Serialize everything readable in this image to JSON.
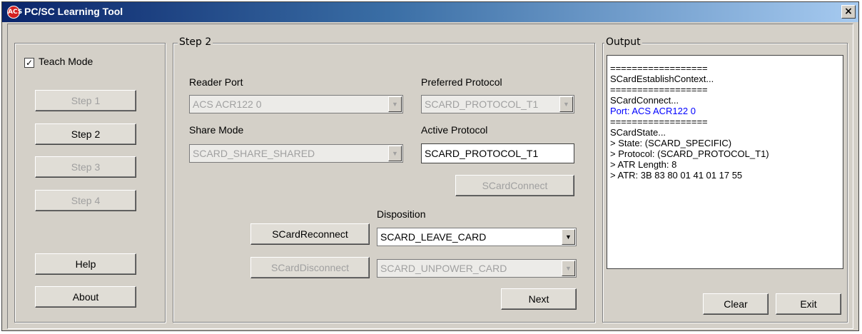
{
  "window": {
    "title": "PC/SC Learning Tool",
    "icon": "acs-logo-icon",
    "close_label": "×"
  },
  "left_panel": {
    "teach_mode_label": "Teach Mode",
    "teach_mode_checked": true,
    "steps": [
      {
        "label": "Step 1",
        "enabled": false
      },
      {
        "label": "Step 2",
        "enabled": true
      },
      {
        "label": "Step 3",
        "enabled": false
      },
      {
        "label": "Step 4",
        "enabled": false
      }
    ],
    "help_label": "Help",
    "about_label": "About"
  },
  "step_panel": {
    "title": "Step 2",
    "reader_port_label": "Reader Port",
    "reader_port_value": "ACS ACR122 0",
    "preferred_protocol_label": "Preferred Protocol",
    "preferred_protocol_value": "SCARD_PROTOCOL_T1",
    "share_mode_label": "Share Mode",
    "share_mode_value": "SCARD_SHARE_SHARED",
    "active_protocol_label": "Active Protocol",
    "active_protocol_value": "SCARD_PROTOCOL_T1",
    "connect_label": "SCardConnect",
    "disposition_label": "Disposition",
    "reconnect_label": "SCardReconnect",
    "reconnect_disposition": "SCARD_LEAVE_CARD",
    "disconnect_label": "SCardDisconnect",
    "disconnect_disposition": "SCARD_UNPOWER_CARD",
    "next_label": "Next"
  },
  "output_panel": {
    "title": "Output",
    "lines": [
      {
        "text": "==================",
        "color": "#000000"
      },
      {
        "text": "SCardEstablishContext...",
        "color": "#000000"
      },
      {
        "text": "==================",
        "color": "#000000"
      },
      {
        "text": "SCardConnect...",
        "color": "#000000"
      },
      {
        "text": "Port: ACS ACR122 0",
        "color": "#0000ff"
      },
      {
        "text": "==================",
        "color": "#000000"
      },
      {
        "text": "SCardState...",
        "color": "#000000"
      },
      {
        "text": "> State: (SCARD_SPECIFIC)",
        "color": "#000000"
      },
      {
        "text": "> Protocol: (SCARD_PROTOCOL_T1)",
        "color": "#000000"
      },
      {
        "text": "> ATR Length: 8",
        "color": "#000000"
      },
      {
        "text": "> ATR: 3B 83 80 01 41 01 17 55",
        "color": "#000000"
      }
    ],
    "clear_label": "Clear",
    "exit_label": "Exit"
  }
}
